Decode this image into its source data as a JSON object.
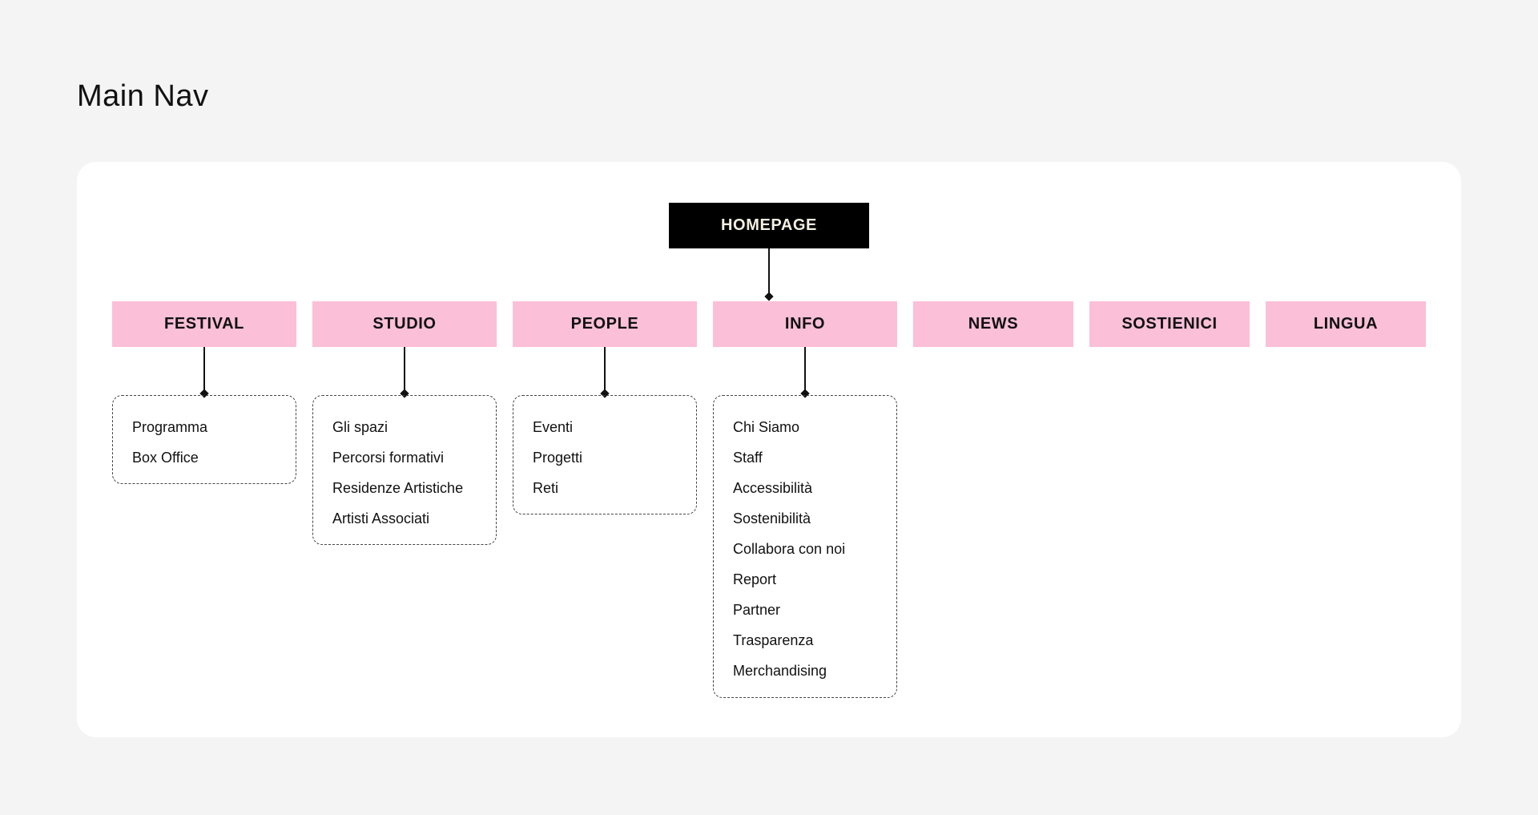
{
  "title": "Main Nav",
  "colors": {
    "background": "#f4f4f4",
    "card": "#ffffff",
    "root_fill": "#000000",
    "root_text": "#f3efe3",
    "section_fill": "#fbbfd8",
    "line": "#111111"
  },
  "root": {
    "label": "HOMEPAGE"
  },
  "sections": [
    {
      "label": "FESTIVAL",
      "children": [
        "Programma",
        "Box Office"
      ]
    },
    {
      "label": "STUDIO",
      "children": [
        "Gli spazi",
        "Percorsi formativi",
        "Residenze Artistiche",
        "Artisti Associati"
      ]
    },
    {
      "label": "PEOPLE",
      "children": [
        "Eventi",
        "Progetti",
        "Reti"
      ]
    },
    {
      "label": "INFO",
      "children": [
        "Chi Siamo",
        "Staff",
        "Accessibilità",
        "Sostenibilità",
        "Collabora con noi",
        "Report",
        "Partner",
        "Trasparenza",
        "Merchandising"
      ]
    },
    {
      "label": "NEWS",
      "children": []
    },
    {
      "label": "SOSTIENICI",
      "children": []
    },
    {
      "label": "LINGUA",
      "children": []
    }
  ]
}
